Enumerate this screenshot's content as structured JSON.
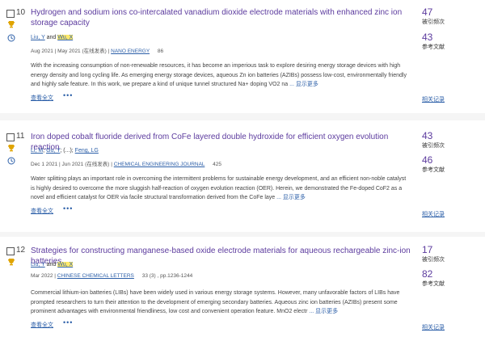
{
  "results": [
    {
      "number": "10",
      "title": "Hydrogen and sodium ions co-intercalated vanadium dioxide electrode materials with enhanced zinc ion storage capacity",
      "authors": [
        {
          "text": "Liu, Y",
          "link": true,
          "highlight": false
        },
        {
          "text": " and ",
          "link": false,
          "highlight": false
        },
        {
          "text": "Wu, X",
          "link": true,
          "highlight": true
        }
      ],
      "date": "Aug 2021 | May 2021 (在线发表) |",
      "journal": "NANO ENERGY",
      "volume": "86",
      "abstract": "With the increasing consumption of non-renewable resources, it has become an imperious task to explore desiring energy storage devices with high energy density and long cycling life. As emerging energy storage devices, aqueous Zn ion batteries (AZIBs) possess low-cost, environmentally friendly and highly safe feature. In this work, we prepare a kind of unique tunnel structured Na+ doping VO2 na",
      "more": "...  显示更多",
      "fulltext": "查看全文",
      "citations": "47",
      "citations_label": "被引频次",
      "references": "43",
      "references_label": "参考文献",
      "related": "相关记录"
    },
    {
      "number": "11",
      "title": "Iron doped cobalt fluoride derived from CoFe layered double hydroxide for efficient oxygen evolution reaction",
      "authors": [
        {
          "text": "Li, M",
          "link": true,
          "highlight": false
        },
        {
          "text": "; ",
          "link": false,
          "highlight": false
        },
        {
          "text": "Gu, Y",
          "link": true,
          "highlight": false
        },
        {
          "text": "; (...); ",
          "link": false,
          "highlight": false
        },
        {
          "text": "Feng, LG",
          "link": true,
          "highlight": false
        }
      ],
      "date": "Dec 1 2021 | Jun 2021 (在线发表) |",
      "journal": "CHEMICAL ENGINEERING JOURNAL",
      "volume": "425",
      "abstract": "Water splitting plays an important role in overcoming the intermittent problems for sustainable energy development, and an efficient non-noble catalyst is highly desired to overcome the more sluggish half-reaction of oxygen evolution reaction (OER). Herein, we demonstrated the Fe-doped CoF2 as a novel and efficient catalyst for OER via facile structural transformation derived from the CoFe laye",
      "more": "...  显示更多",
      "fulltext": "查看全文",
      "citations": "43",
      "citations_label": "被引频次",
      "references": "46",
      "references_label": "参考文献",
      "related": "相关记录"
    },
    {
      "number": "12",
      "title": "Strategies for constructing manganese-based oxide electrode materials for aqueous rechargeable zinc-ion batteries",
      "authors": [
        {
          "text": "Liu, Y",
          "link": true,
          "highlight": false
        },
        {
          "text": " and ",
          "link": false,
          "highlight": false
        },
        {
          "text": "Wu, X",
          "link": true,
          "highlight": true
        }
      ],
      "date": "Mar 2022 |",
      "journal": "CHINESE CHEMICAL LETTERS",
      "volume": "33 (3) , pp.1236-1244",
      "abstract": "Commercial lithium-ion batteries (LIBs) have been widely used in various energy storage systems. However, many unfavorable factors of LIBs have prompted researchers to turn their attention to the development of emerging secondary batteries. Aqueous zinc ion batteries (AZIBs) present some prominent advantages with environmental friendliness, low cost and convenient operation feature. MnO2 electr",
      "more": "...  显示更多",
      "fulltext": "查看全文",
      "citations": "17",
      "citations_label": "被引频次",
      "references": "82",
      "references_label": "参考文献",
      "related": "相关记录"
    }
  ]
}
